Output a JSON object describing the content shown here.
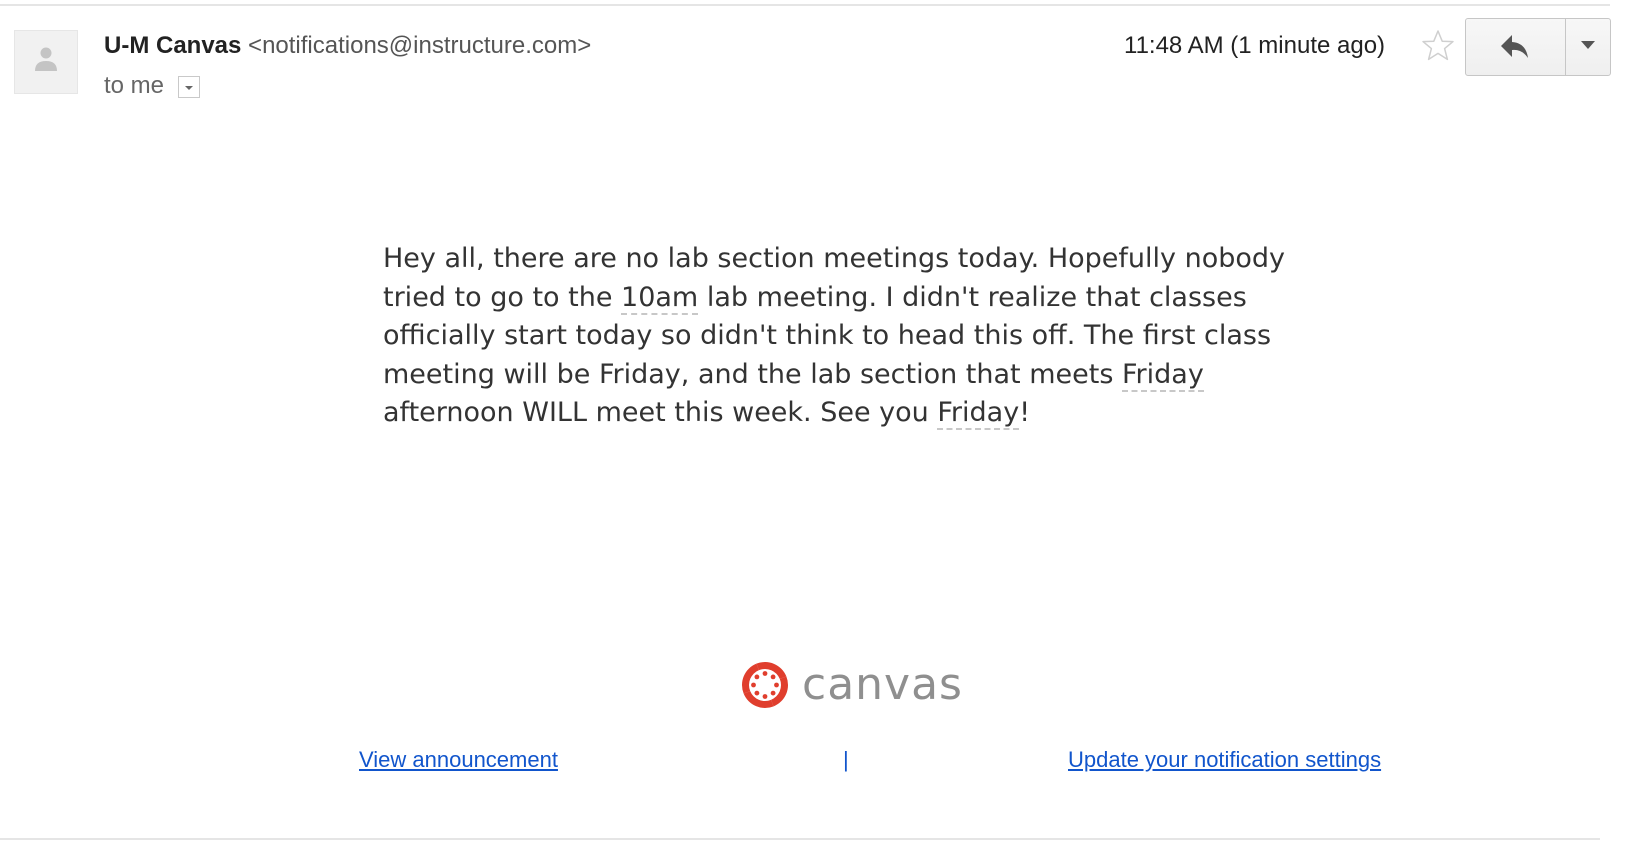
{
  "header": {
    "sender_name": "U-M Canvas",
    "sender_email": "<notifications@instructure.com>",
    "recipient_label": "to me",
    "timestamp": "11:48 AM (1 minute ago)"
  },
  "icons": {
    "avatar": "default-avatar-icon",
    "recipient_menu": "chevron-down-icon",
    "star": "star-outline-icon",
    "reply": "reply-arrow-icon",
    "more": "caret-down-icon",
    "logo_mark": "canvas-logo-icon"
  },
  "body": {
    "part1": "Hey all, there are no lab section meetings today. Hopefully nobody tried to go to the ",
    "time_highlight": "10am",
    "part2": " lab meeting. I didn't realize that classes officially start today so didn't think to head this off. The first class meeting will be Friday, and the lab section that meets ",
    "friday_highlight_1": "Friday",
    "part3": " afternoon WILL meet this week. See you ",
    "friday_highlight_2": "Friday",
    "part4": "!"
  },
  "footer": {
    "logo_text": "canvas",
    "view_link": "View announcement",
    "separator": "|",
    "settings_link": "Update your notification settings"
  },
  "colors": {
    "link": "#1155cc",
    "logo_red": "#e03e2d",
    "logo_text": "#8f8f8f"
  }
}
